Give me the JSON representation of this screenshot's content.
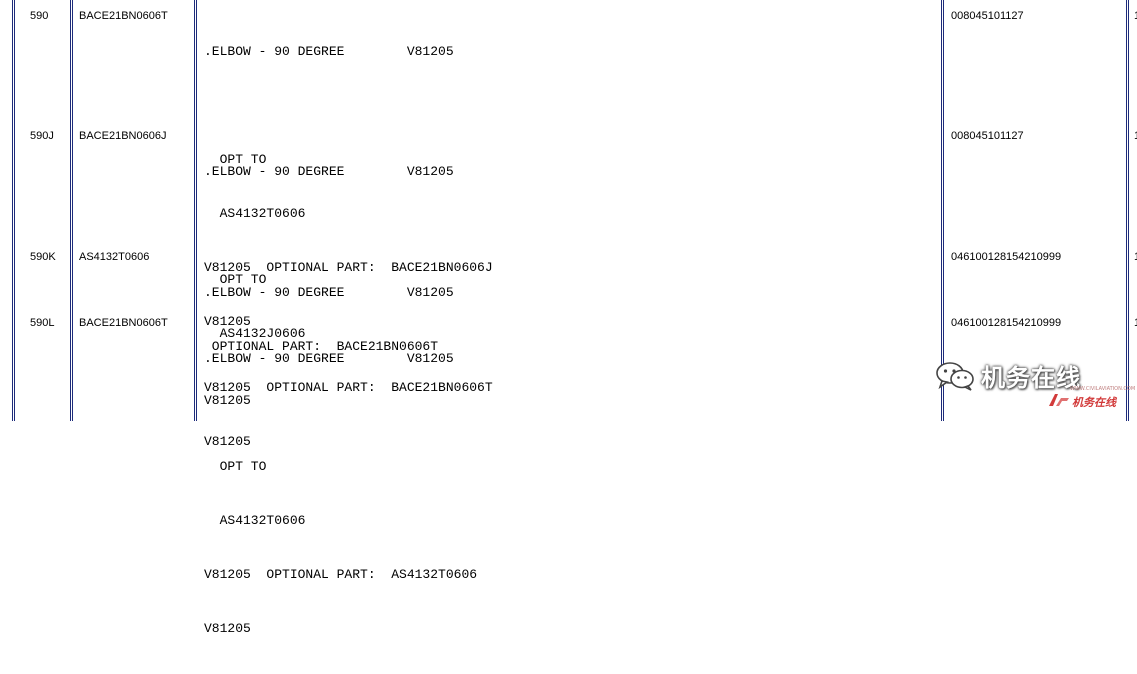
{
  "rows": [
    {
      "item": "590",
      "part": "BACE21BN0606T",
      "desc": [
        ".ELBOW - 90 DEGREE        V81205",
        "",
        "  OPT TO",
        "  AS4132T0606",
        "V81205  OPTIONAL PART:  BACE21BN0606J",
        "V81205"
      ],
      "code": "008045101127",
      "edge": "1"
    },
    {
      "item": "590J",
      "part": "BACE21BN0606J",
      "desc": [
        ".ELBOW - 90 DEGREE        V81205",
        "",
        "  OPT TO",
        "  AS4132J0606",
        "V81205  OPTIONAL PART:  BACE21BN0606T",
        "V81205"
      ],
      "code": "008045101127",
      "edge": "1"
    },
    {
      "item": "590K",
      "part": "AS4132T0606",
      "desc": [
        ".ELBOW - 90 DEGREE        V81205",
        " OPTIONAL PART:  BACE21BN0606T",
        "V81205"
      ],
      "code": "046100128154210999",
      "edge": "1"
    },
    {
      "item": "590L",
      "part": "BACE21BN0606T",
      "desc": [
        ".ELBOW - 90 DEGREE        V81205",
        "",
        "  OPT TO",
        "  AS4132T0606",
        "V81205  OPTIONAL PART:  AS4132T0606",
        "V81205"
      ],
      "code": "046100128154210999",
      "edge": "1"
    }
  ],
  "watermark": {
    "main": "机务在线",
    "small": "机务在线",
    "url": "WWW.CIVILAVIATION.COM",
    "icon": "wechat-icon"
  },
  "colors": {
    "rule": "#1d2b7a",
    "watermark_red": "#d23a3a"
  }
}
